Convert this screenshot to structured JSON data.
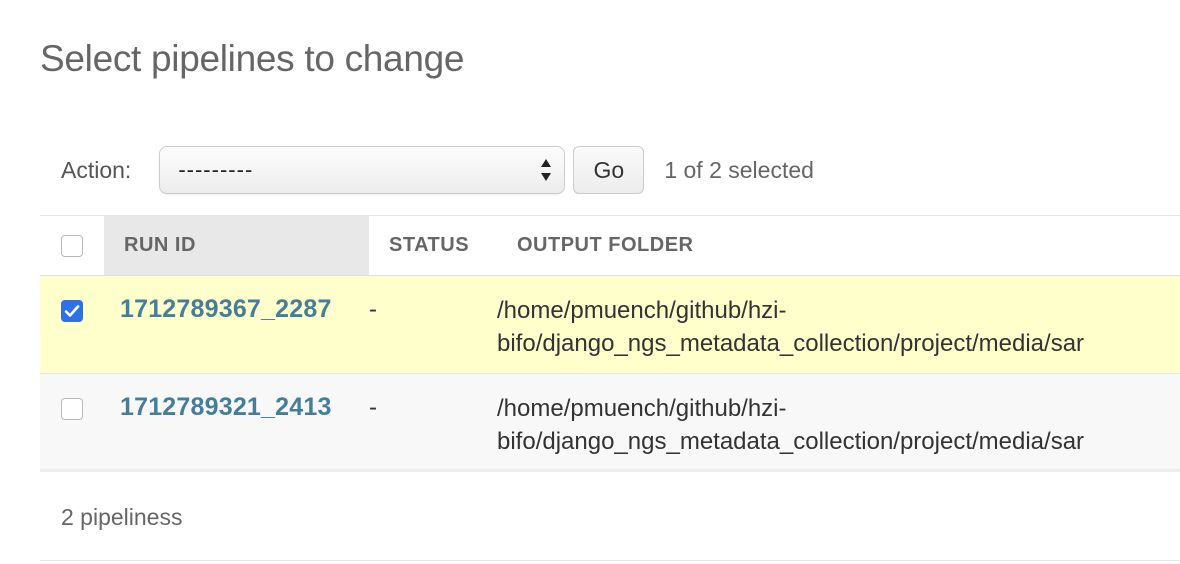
{
  "page": {
    "title": "Select pipelines to change"
  },
  "actions": {
    "label": "Action:",
    "selected_option": "---------",
    "go_label": "Go",
    "selection_counter": "1 of 2 selected"
  },
  "table": {
    "columns": [
      "RUN ID",
      "STATUS",
      "OUTPUT FOLDER"
    ],
    "rows": [
      {
        "run_id": "1712789367_2287",
        "status": "-",
        "output_line1": "/home/pmuench/github/hzi-",
        "output_line2": "bifo/django_ngs_metadata_collection/project/media/sar",
        "checked": true
      },
      {
        "run_id": "1712789321_2413",
        "status": "-",
        "output_line1": "/home/pmuench/github/hzi-",
        "output_line2": "bifo/django_ngs_metadata_collection/project/media/sar",
        "checked": false
      }
    ]
  },
  "footer": {
    "count_text": "2 pipeliness"
  },
  "colors": {
    "link": "#447e9b",
    "selected_row": "#ffffcc",
    "checkbox_checked": "#2f6fe8"
  }
}
